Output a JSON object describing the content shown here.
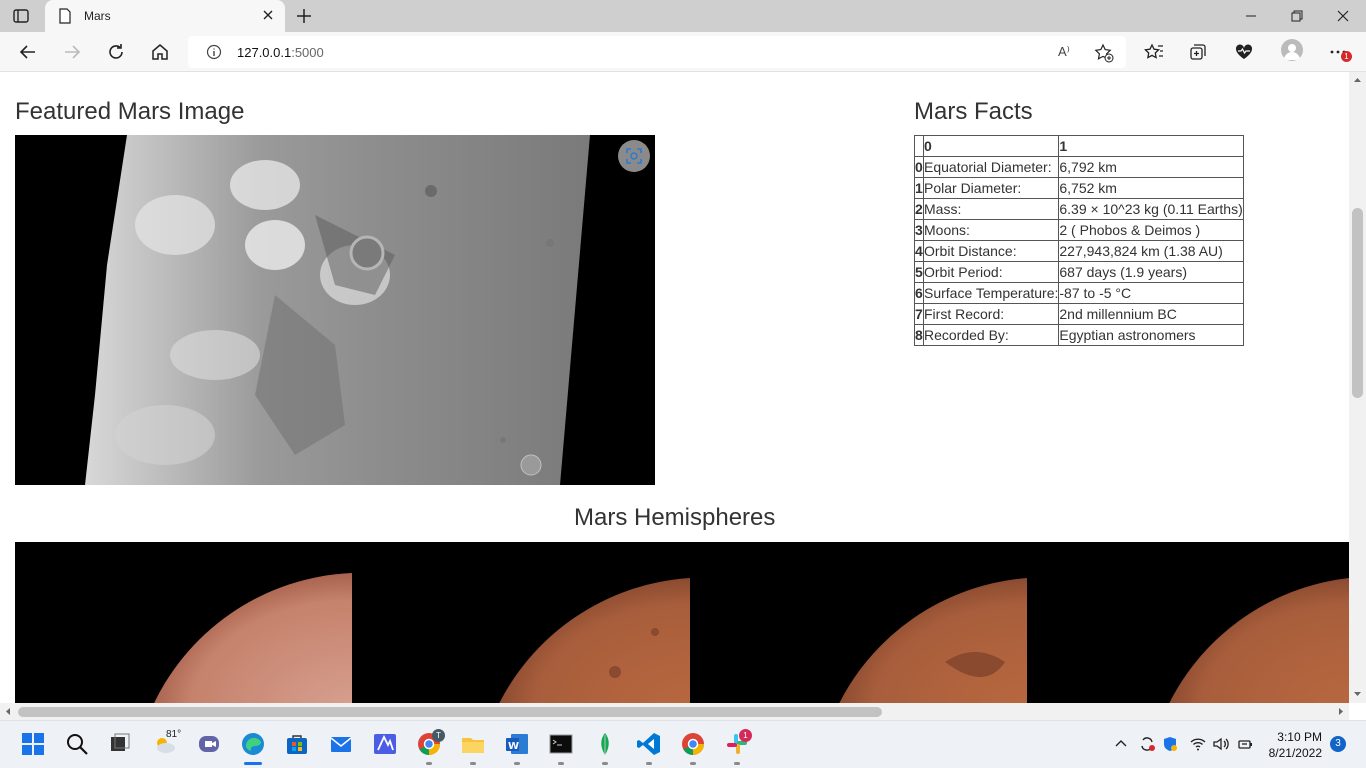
{
  "browser": {
    "tab_title": "Mars",
    "url_host": "127.0.0.1",
    "url_port": ":5000",
    "read_aloud": "A⁾",
    "menu_badge": "1"
  },
  "page": {
    "featured_heading": "Featured Mars Image",
    "facts_heading": "Mars Facts",
    "hemispheres_heading": "Mars Hemispheres",
    "facts_table": {
      "header": [
        "",
        "0",
        "1"
      ],
      "rows": [
        {
          "idx": "0",
          "label": "Equatorial Diameter:",
          "value": "6,792 km"
        },
        {
          "idx": "1",
          "label": "Polar Diameter:",
          "value": "6,752 km"
        },
        {
          "idx": "2",
          "label": "Mass:",
          "value": "6.39 × 10^23 kg (0.11 Earths)"
        },
        {
          "idx": "3",
          "label": "Moons:",
          "value": "2 ( Phobos & Deimos )"
        },
        {
          "idx": "4",
          "label": "Orbit Distance:",
          "value": "227,943,824 km (1.38 AU)"
        },
        {
          "idx": "5",
          "label": "Orbit Period:",
          "value": "687 days (1.9 years)"
        },
        {
          "idx": "6",
          "label": "Surface Temperature:",
          "value": "-87 to -5 °C"
        },
        {
          "idx": "7",
          "label": "First Record:",
          "value": "2nd millennium BC"
        },
        {
          "idx": "8",
          "label": "Recorded By:",
          "value": "Egyptian astronomers"
        }
      ]
    }
  },
  "taskbar": {
    "weather_temp": "81°",
    "chrome_profile_badge": "T",
    "slack_badge": "1",
    "time": "3:10 PM",
    "date": "8/21/2022",
    "notification_count": "3"
  },
  "colors": {
    "mars_surface": "#c07a5a",
    "edge_accent": "#1a73e8"
  }
}
